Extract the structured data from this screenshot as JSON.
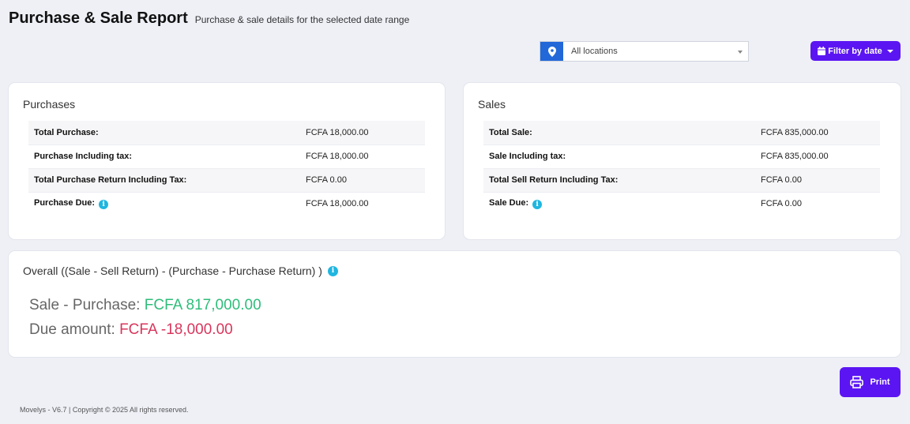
{
  "header": {
    "title": "Purchase & Sale Report",
    "subtitle": "Purchase & sale details for the selected date range"
  },
  "location": {
    "icon": "map-marker-icon",
    "selected": "All locations"
  },
  "filter_button": {
    "icon": "calendar-icon",
    "label": "Filter by date"
  },
  "purchases": {
    "title": "Purchases",
    "rows": [
      {
        "label": "Total Purchase:",
        "value": "FCFA 18,000.00"
      },
      {
        "label": "Purchase Including tax:",
        "value": "FCFA 18,000.00"
      },
      {
        "label": "Total Purchase Return Including Tax:",
        "value": "FCFA 0.00"
      },
      {
        "label": "Purchase Due:",
        "value": "FCFA 18,000.00"
      }
    ]
  },
  "sales": {
    "title": "Sales",
    "rows": [
      {
        "label": "Total Sale:",
        "value": "FCFA 835,000.00"
      },
      {
        "label": "Sale Including tax:",
        "value": "FCFA 835,000.00"
      },
      {
        "label": "Total Sell Return Including Tax:",
        "value": "FCFA 0.00"
      },
      {
        "label": "Sale Due:",
        "value": "FCFA 0.00"
      }
    ]
  },
  "overall": {
    "title": "Overall ((Sale - Sell Return) - (Purchase - Purchase Return) )",
    "sale_purchase_label": "Sale - Purchase:",
    "sale_purchase_value": "FCFA 817,000.00",
    "due_label": "Due amount:",
    "due_value": "FCFA -18,000.00"
  },
  "info_icon_glyph": "i",
  "print_button": {
    "icon": "printer-icon",
    "label": "Print"
  },
  "footer": {
    "text": "Movelys - V6.7 | Copyright © 2025 All rights reserved."
  },
  "colors": {
    "accent": "#5b15f2",
    "location_icon_bg": "#2268d8",
    "positive": "#2ebd7a",
    "negative": "#d8365c",
    "info": "#1fb6e0"
  }
}
